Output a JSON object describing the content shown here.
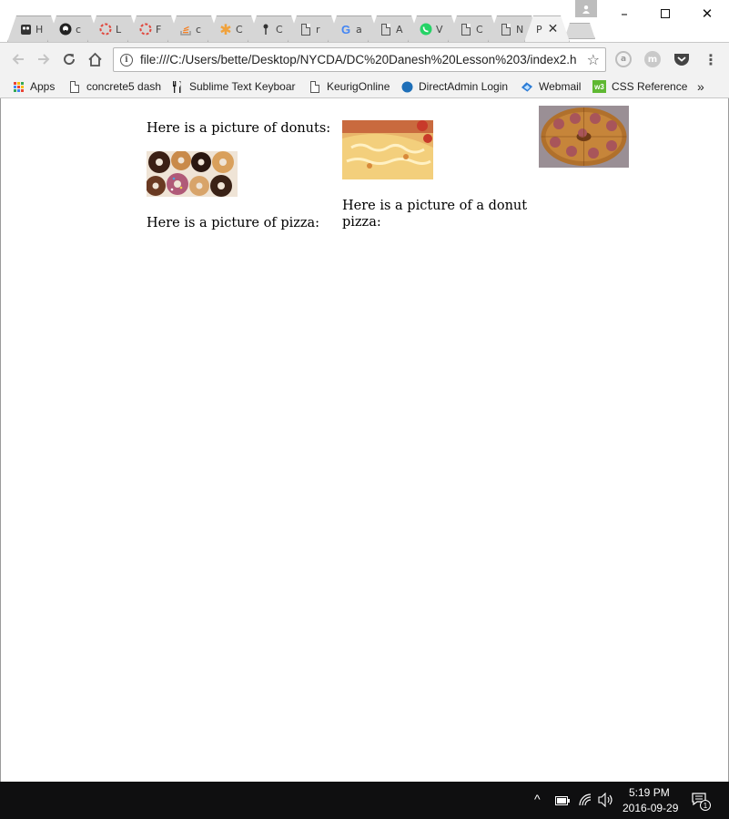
{
  "browser": {
    "tabs": [
      {
        "favicon": "owl-icon",
        "label": "H"
      },
      {
        "favicon": "github-icon",
        "label": "c"
      },
      {
        "favicon": "loading-ring-icon",
        "label": "L"
      },
      {
        "favicon": "loading-ring-icon",
        "label": "F"
      },
      {
        "favicon": "stackoverflow-icon",
        "label": "c"
      },
      {
        "favicon": "asterisk-icon",
        "label": "C"
      },
      {
        "favicon": "pin-icon",
        "label": "C"
      },
      {
        "favicon": "page-icon",
        "label": "r"
      },
      {
        "favicon": "google-icon",
        "label": "a"
      },
      {
        "favicon": "page-icon",
        "label": "A"
      },
      {
        "favicon": "whatsapp-icon",
        "label": "V"
      },
      {
        "favicon": "page-icon",
        "label": "C"
      },
      {
        "favicon": "page-icon",
        "label": "N"
      },
      {
        "favicon": "",
        "label": "P",
        "active": true
      }
    ],
    "window_controls": {
      "minimize": "–",
      "maximize": "☐",
      "close": "✕"
    },
    "address": "file:///C:/Users/bette/Desktop/NYCDA/DC%20Danesh%20Lesson%203/index2.h",
    "bookmarks": [
      {
        "icon": "apps-icon",
        "label": "Apps"
      },
      {
        "icon": "page-icon",
        "label": "concrete5 dash"
      },
      {
        "icon": "fork-knife-icon",
        "label": "Sublime Text Keyboar"
      },
      {
        "icon": "page-icon",
        "label": "KeurigOnline"
      },
      {
        "icon": "directadmin-icon",
        "label": "DirectAdmin Login"
      },
      {
        "icon": "webmail-icon",
        "label": "Webmail"
      },
      {
        "icon": "w3-icon",
        "label": "CSS Reference"
      }
    ],
    "bookmarks_overflow": "»"
  },
  "page": {
    "col1": {
      "donut_caption": "Here is a picture of donuts:",
      "pizza_caption": "Here is a picture of pizza:"
    },
    "col2": {
      "donut_pizza_caption_line1": "Here is a picture of a donut",
      "donut_pizza_caption_line2": "pizza:"
    }
  },
  "taskbar": {
    "time": "5:19 PM",
    "date": "2016-09-29",
    "notification_count": "1"
  },
  "colors": {
    "tab_bg": "#d6d6d6",
    "toolbar_bg": "#f2f2f2",
    "taskbar_bg": "#0f0f10"
  }
}
